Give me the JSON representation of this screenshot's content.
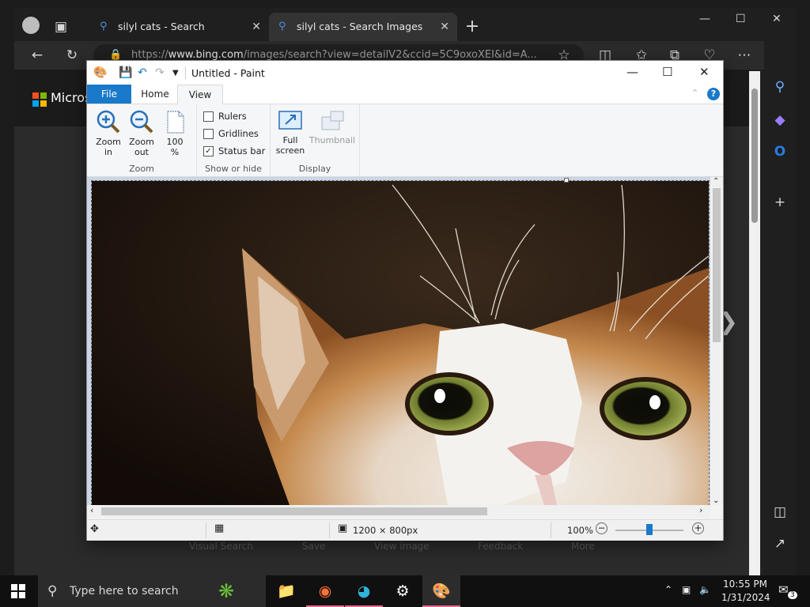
{
  "browser": {
    "tabs": [
      {
        "label": "silyl cats - Search",
        "active": false
      },
      {
        "label": "silyl cats - Search Images",
        "active": true
      }
    ],
    "url_prefix": "https://",
    "url_host": "www.bing.com",
    "url_path": "/images/search?view=detailV2&ccid=5C9oxoXEI&id=A...",
    "page": {
      "ms_brand_partial": "Micros",
      "bottom_actions": [
        "Visual Search",
        "Save",
        "View image",
        "Feedback",
        "More"
      ]
    }
  },
  "paint": {
    "title": "Untitled - Paint",
    "ribbon_tabs": [
      "File",
      "Home",
      "View"
    ],
    "active_tab": "View",
    "groups": {
      "zoom": {
        "label": "Zoom",
        "buttons": [
          {
            "line1": "Zoom",
            "line2": "in"
          },
          {
            "line1": "Zoom",
            "line2": "out"
          },
          {
            "line1": "100",
            "line2": "%"
          }
        ]
      },
      "show_hide": {
        "label": "Show or hide",
        "options": [
          {
            "label": "Rulers",
            "checked": false
          },
          {
            "label": "Gridlines",
            "checked": false
          },
          {
            "label": "Status bar",
            "checked": true
          }
        ]
      },
      "display": {
        "label": "Display",
        "buttons": [
          {
            "line1": "Full",
            "line2": "screen",
            "enabled": true
          },
          {
            "line1": "Thumbnail",
            "line2": "",
            "enabled": false
          }
        ]
      }
    },
    "status": {
      "image_size": "1200 × 800px",
      "zoom": "100%",
      "zoom_fraction": 0.5
    }
  },
  "taskbar": {
    "search_placeholder": "Type here to search",
    "time": "10:55 PM",
    "date": "1/31/2024",
    "notification_count": "3"
  },
  "colors": {
    "paint_accent": "#1979ca",
    "canvas_background": "#cad6e6",
    "browser_dark": "#202020"
  }
}
